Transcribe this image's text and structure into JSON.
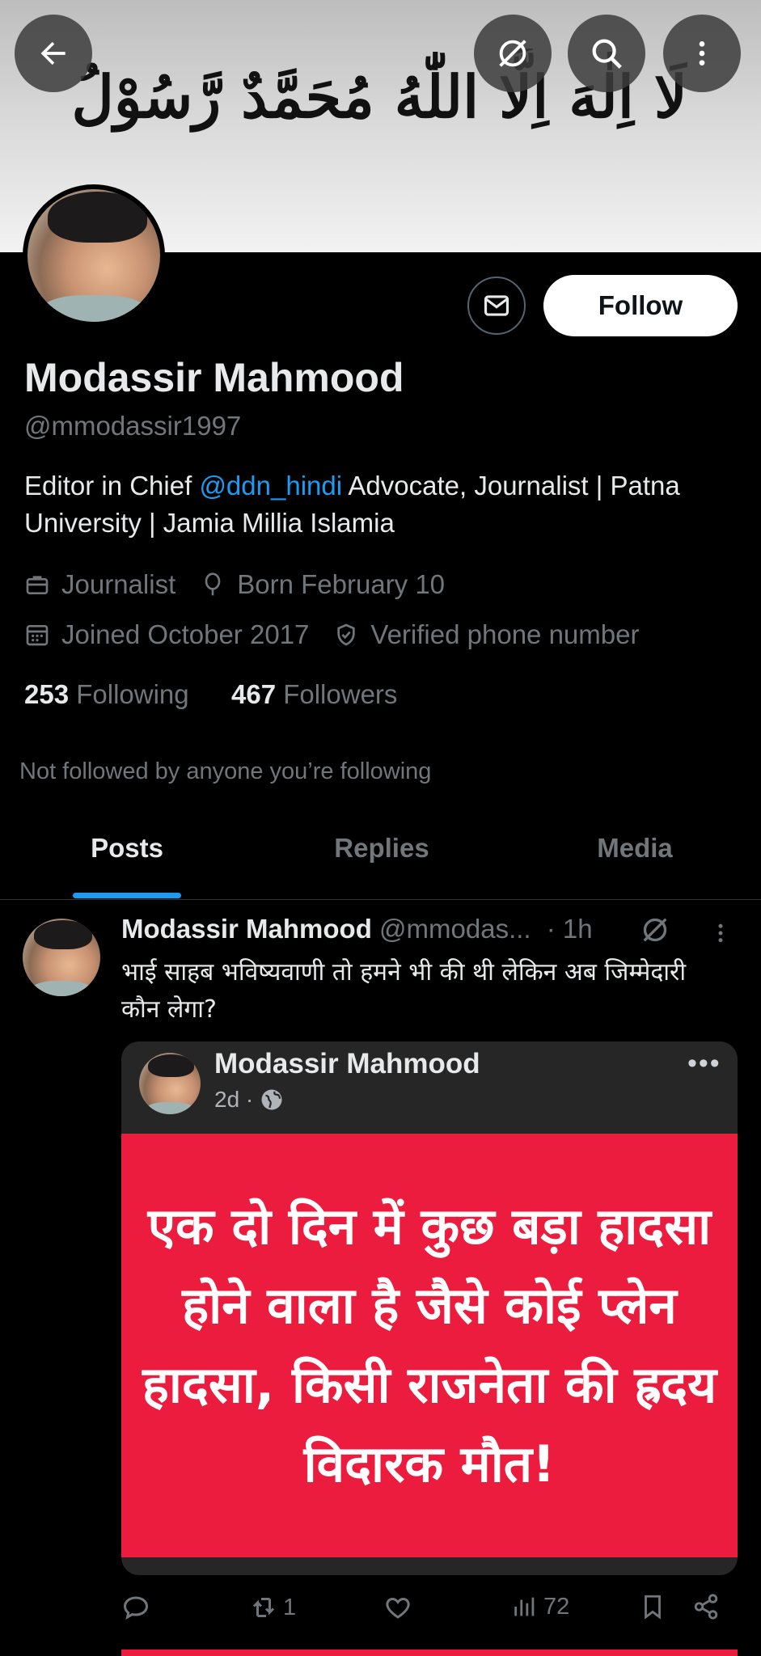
{
  "banner": {
    "calligraphy": "لَا اِلٰهَ اِلَّا اللّٰهُ مُحَمَّدٌ رَّسُوْلُ اللّٰهِ"
  },
  "top_bar": {
    "back_icon": "arrow-left-icon",
    "grok_icon": "grok-icon",
    "search_icon": "search-icon",
    "more_icon": "more-vertical-icon"
  },
  "profile": {
    "display_name": "Modassir Mahmood",
    "handle": "@mmodassir1997",
    "follow_label": "Follow",
    "bio_before": "Editor in Chief ",
    "bio_mention": "@ddn_hindi",
    "bio_after": " Advocate, Journalist  |  Patna University | Jamia Millia Islamia",
    "profession": "Journalist",
    "birthday": "Born February 10",
    "joined": "Joined October 2017",
    "verified": "Verified phone number",
    "following_count": "253",
    "following_label": "Following",
    "followers_count": "467",
    "followers_label": "Followers",
    "not_followed": "Not followed by anyone you’re following"
  },
  "tabs": [
    {
      "label": "Posts",
      "active": true
    },
    {
      "label": "Replies",
      "active": false
    },
    {
      "label": "Media",
      "active": false
    }
  ],
  "post": {
    "author": "Modassir Mahmood",
    "handle": "@mmodas...",
    "time": "· 1h",
    "text": "भाई साहब भविष्यवाणी तो हमने भी की थी लेकिन अब जिम्मेदारी कौन लेगा?",
    "card": {
      "author": "Modassir Mahmood",
      "age": "2d ·",
      "more": "•••",
      "image_text": "एक दो दिन में कुछ बड़ा हादसा होने वाला है जैसे कोई प्लेन हादसा, किसी राजनेता की ह्रदय विदारक मौत!"
    },
    "actions": {
      "replies": "",
      "reposts": "1",
      "likes": "",
      "views": "72"
    }
  },
  "colors": {
    "accent": "#1d9bf0",
    "card_image_bg": "#ec1c3e",
    "muted": "#71767b"
  }
}
